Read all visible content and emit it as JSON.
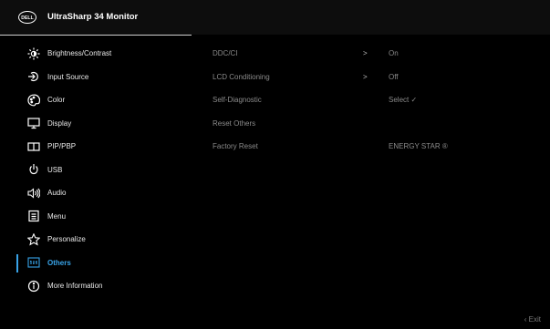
{
  "header": {
    "logo_text": "DELL",
    "title": "UltraSharp 34 Monitor"
  },
  "menu": [
    {
      "label": "Brightness/Contrast",
      "icon": "brightness-icon"
    },
    {
      "label": "Input Source",
      "icon": "input-source-icon"
    },
    {
      "label": "Color",
      "icon": "color-palette-icon"
    },
    {
      "label": "Display",
      "icon": "display-icon"
    },
    {
      "label": "PIP/PBP",
      "icon": "pip-pbp-icon"
    },
    {
      "label": "USB",
      "icon": "usb-icon"
    },
    {
      "label": "Audio",
      "icon": "speaker-icon"
    },
    {
      "label": "Menu",
      "icon": "menu-icon"
    },
    {
      "label": "Personalize",
      "icon": "star-icon"
    },
    {
      "label": "Others",
      "icon": "others-icon",
      "active": true
    },
    {
      "label": "More Information",
      "icon": "info-icon"
    }
  ],
  "options": [
    {
      "name": "DDC/CI",
      "arrow": ">",
      "value": "On"
    },
    {
      "name": "LCD Conditioning",
      "arrow": ">",
      "value": "Off"
    },
    {
      "name": "Self-Diagnostic",
      "arrow": "",
      "value": "Select ✓"
    },
    {
      "name": "Reset Others",
      "arrow": "",
      "value": ""
    },
    {
      "name": "Factory Reset",
      "arrow": "",
      "value": "ENERGY STAR ®"
    }
  ],
  "footer": {
    "exit_label": "‹  Exit"
  },
  "colors": {
    "accent": "#38a3e8",
    "background": "#000000",
    "header": "#0d0d0d"
  }
}
